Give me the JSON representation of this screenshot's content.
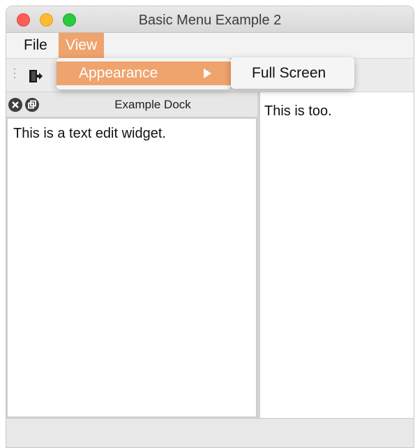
{
  "window": {
    "title": "Basic Menu Example 2"
  },
  "menubar": {
    "items": [
      {
        "label": "File"
      },
      {
        "label": "View"
      }
    ]
  },
  "toolbar": {
    "icons": [
      "exit-icon"
    ]
  },
  "view_menu": {
    "items": [
      {
        "label": "Appearance",
        "has_submenu": true
      }
    ]
  },
  "appearance_submenu": {
    "items": [
      {
        "label": "Full Screen"
      }
    ]
  },
  "dock": {
    "title": "Example Dock",
    "text": "This is a text edit widget."
  },
  "central": {
    "text": "This is too."
  },
  "colors": {
    "menu_highlight": "#efa36d",
    "close_button": "#fc5d55",
    "minimize_button": "#fdbb2f",
    "maximize_button": "#2ac93f"
  }
}
